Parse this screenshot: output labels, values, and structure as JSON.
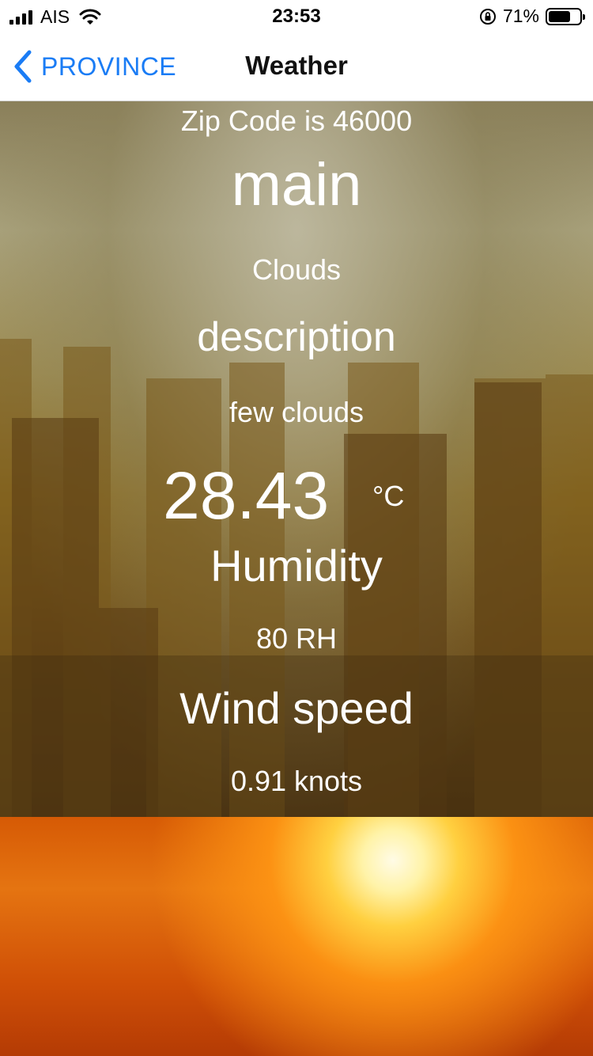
{
  "status_bar": {
    "carrier": "AIS",
    "time": "23:53",
    "battery_percent": "71%",
    "battery_level": 0.71
  },
  "nav": {
    "back_label": "PROVINCE",
    "title": "Weather",
    "accent_color": "#1a7cf5"
  },
  "weather": {
    "zip_line": "Zip Code is 46000",
    "main_label": "main",
    "main_value": "Clouds",
    "description_label": "description",
    "description_value": "few clouds",
    "temperature": "28.43",
    "temperature_unit": "°C",
    "humidity_label": "Humidity",
    "humidity_value": "80 RH",
    "wind_label": "Wind speed",
    "wind_value": "0.91 knots"
  },
  "icons": {
    "signal": "signal-bars-icon",
    "wifi": "wifi-icon",
    "rotation_lock": "rotation-lock-icon",
    "battery": "battery-icon",
    "back": "chevron-left-icon"
  }
}
